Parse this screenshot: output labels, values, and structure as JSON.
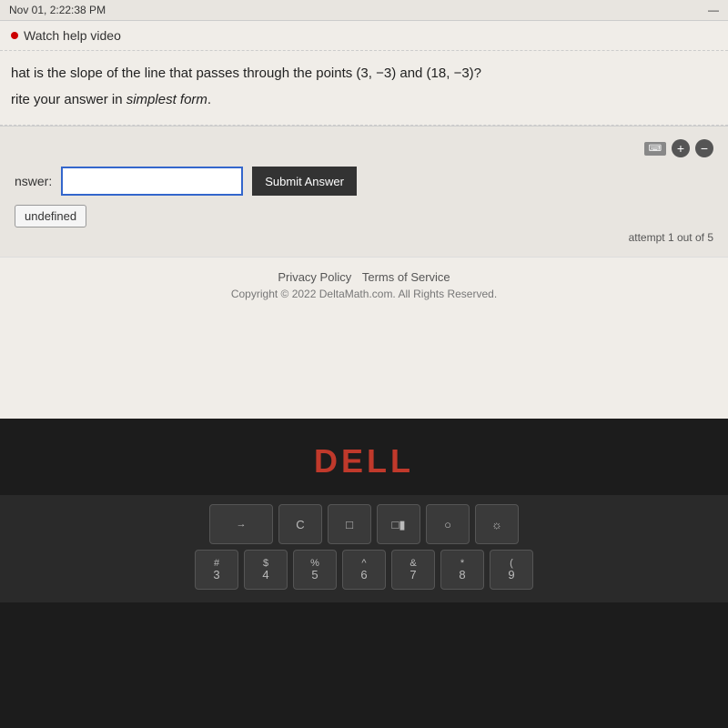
{
  "topbar": {
    "time": "Nov 01, 2:22:38 PM",
    "minimize_icon": "—"
  },
  "watch_help": {
    "label": "Watch help video"
  },
  "question": {
    "line1": "hat is the slope of the line that passes through the points (3, −3) and (18, −3)?",
    "line2": "rite your answer in ",
    "line2_italic": "simplest form",
    "line2_end": "."
  },
  "answer_area": {
    "keyboard_icon": "⌨",
    "zoom_in": "+",
    "zoom_out": "−",
    "label": "nswer:",
    "input_value": "",
    "submit_label": "Submit Answer",
    "undefined_tag": "undefined",
    "attempt_text": "attempt 1 out of 5"
  },
  "footer": {
    "privacy_policy": "Privacy Policy",
    "terms_of_service": "Terms of Service",
    "copyright": "Copyright © 2022 DeltaMath.com. All Rights Reserved."
  },
  "dell_logo": "DELL",
  "keyboard": {
    "row1": [
      {
        "top": "→",
        "bottom": "",
        "wide": true
      },
      {
        "top": "",
        "bottom": "C",
        "wide": false
      },
      {
        "top": "",
        "bottom": "□",
        "wide": false
      },
      {
        "top": "",
        "bottom": "□▮",
        "wide": false
      },
      {
        "top": "",
        "bottom": "○",
        "wide": false
      },
      {
        "top": "",
        "bottom": "☼",
        "wide": false
      }
    ],
    "row2": [
      {
        "top": "#",
        "bottom": "3"
      },
      {
        "top": "$",
        "bottom": "4"
      },
      {
        "top": "%",
        "bottom": "5"
      },
      {
        "top": "^",
        "bottom": "6"
      },
      {
        "top": "&",
        "bottom": "7"
      },
      {
        "top": "*",
        "bottom": "8"
      },
      {
        "top": "(",
        "bottom": "9"
      }
    ]
  }
}
